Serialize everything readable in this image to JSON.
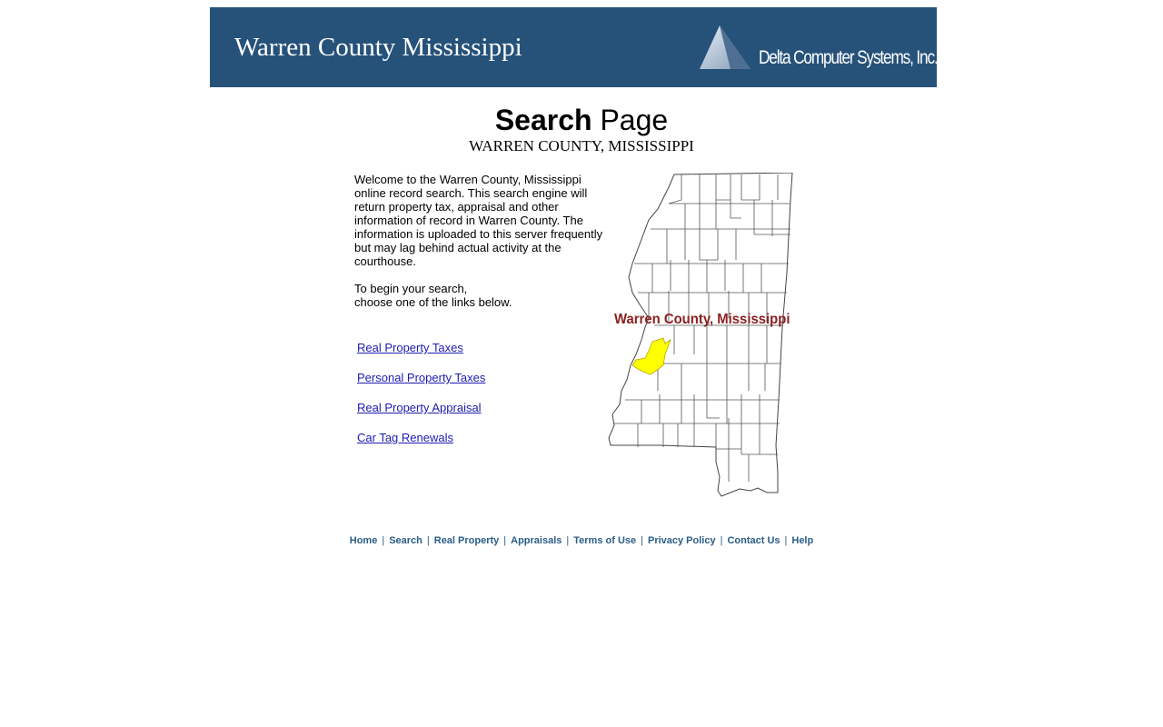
{
  "banner": {
    "title": "Warren County Mississippi",
    "logo_text": "Delta Computer Systems, Inc."
  },
  "heading": {
    "bold": "Search",
    "rest": " Page",
    "subtitle": "WARREN COUNTY, MISSISSIPPI"
  },
  "intro": {
    "paragraph1": "Welcome to the Warren County, Mississippi online record search. This search engine will return property tax, appraisal and other information of record in Warren County. The information is uploaded to this server frequently but may lag behind actual activity at the courthouse.",
    "paragraph2_line1": "To begin your search,",
    "paragraph2_line2": "choose one of the links below."
  },
  "links": [
    {
      "label": "Real Property Taxes"
    },
    {
      "label": "Personal Property Taxes"
    },
    {
      "label": "Real Property Appraisal"
    },
    {
      "label": "Car Tag Renewals"
    }
  ],
  "map": {
    "label": "Warren County, Mississippi",
    "highlight_color": "#ffff00",
    "label_color": "#8b2020"
  },
  "footer": {
    "links": [
      "Home",
      "Search",
      "Real Property",
      "Appraisals",
      "Terms of Use",
      "Privacy Policy",
      "Contact Us",
      "Help"
    ],
    "separator": "|"
  },
  "colors": {
    "banner": "#26527a",
    "link": "#1c1cb0",
    "footer_link": "#2a5d87"
  }
}
